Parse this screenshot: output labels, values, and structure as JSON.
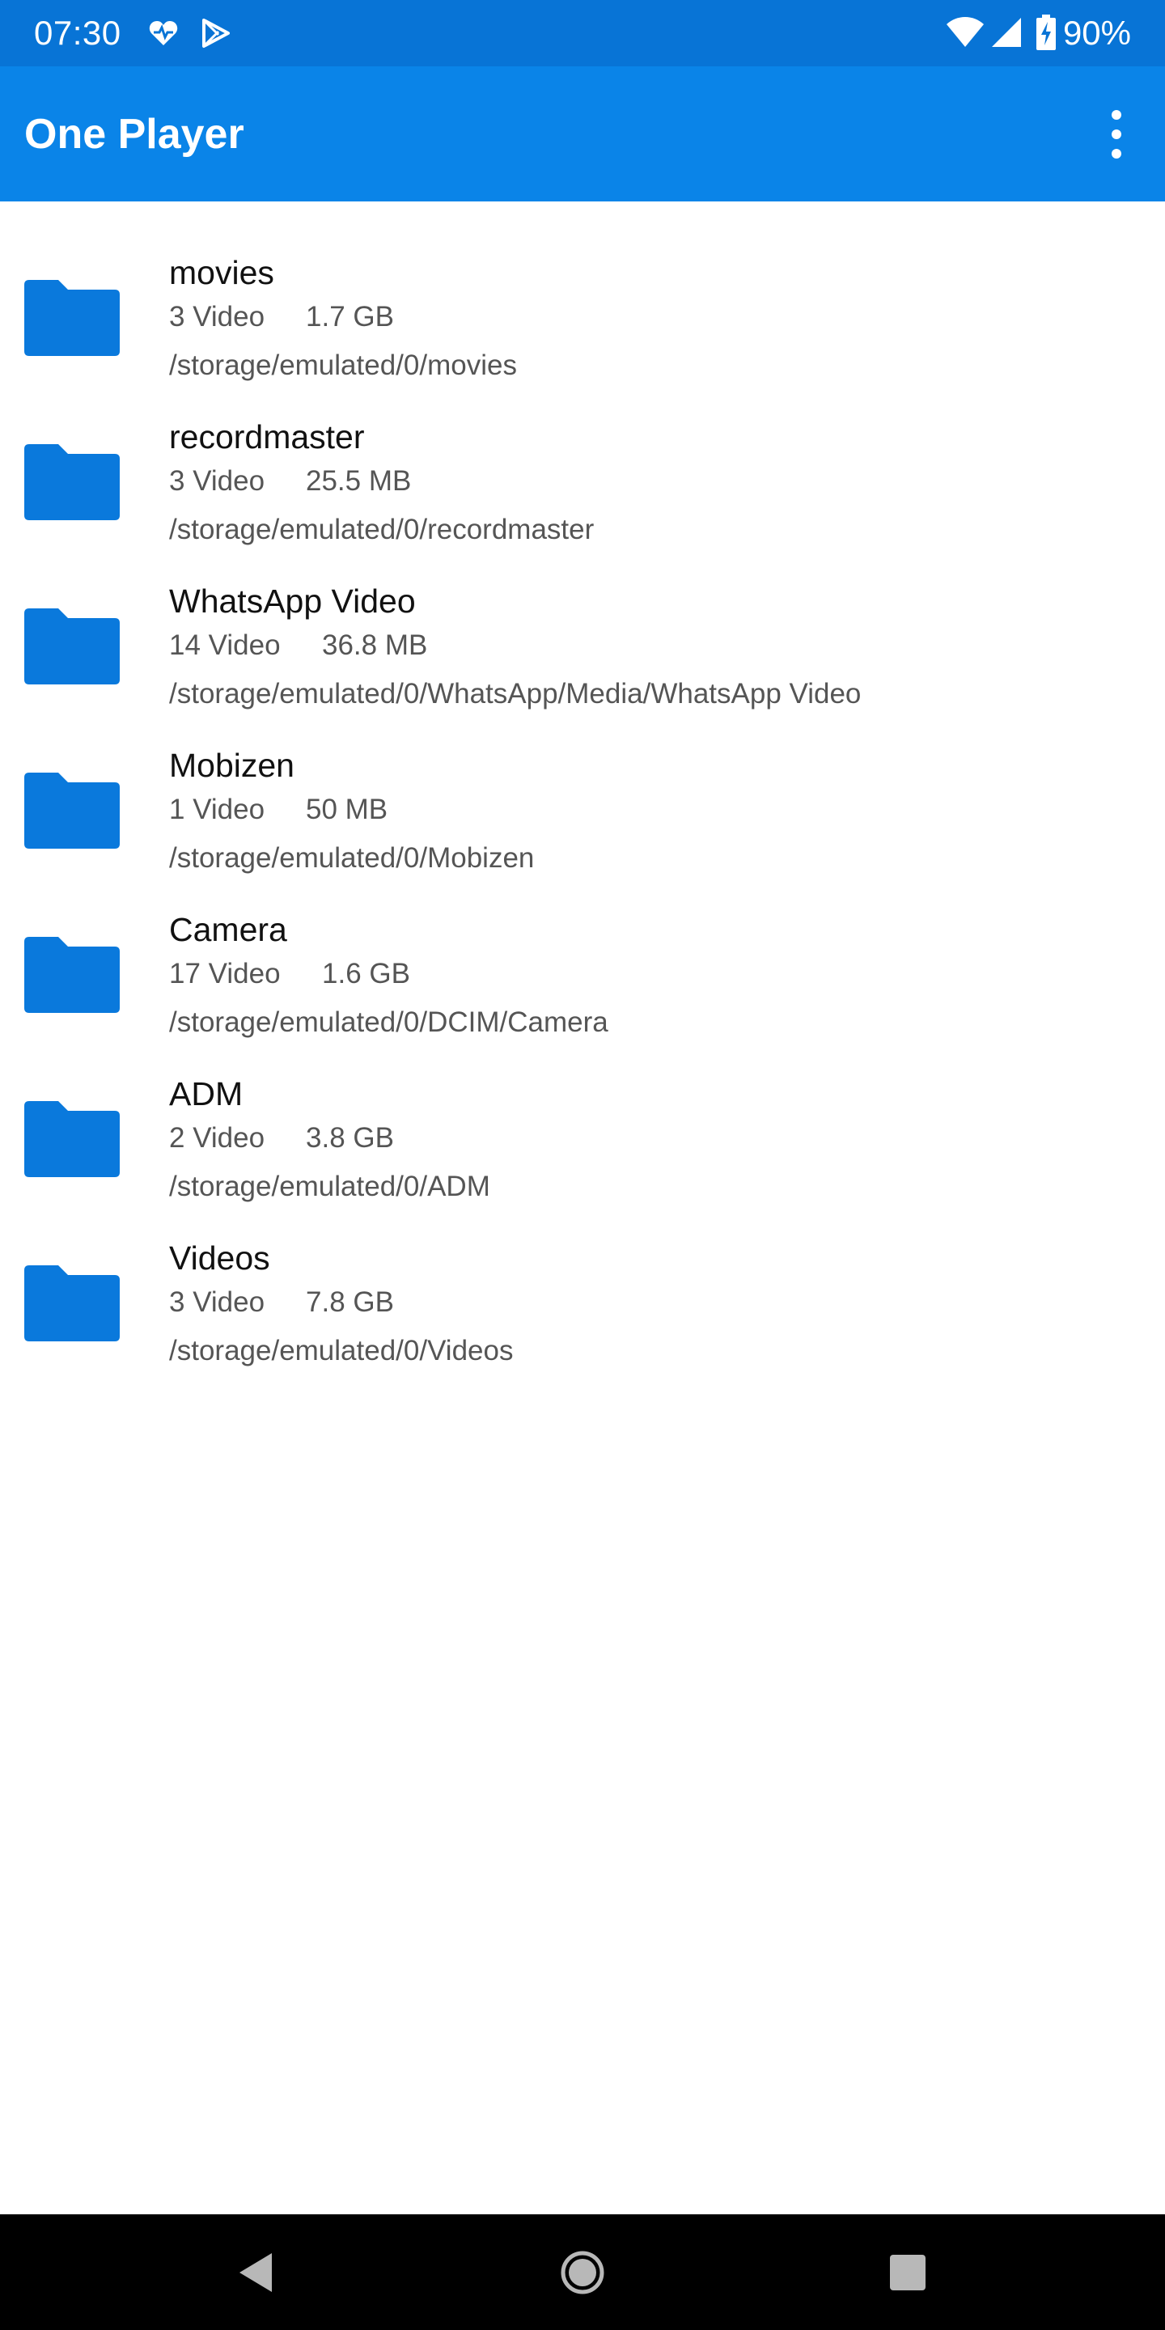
{
  "status_bar": {
    "time": "07:30",
    "battery": "90%",
    "icons": [
      "health-heart-icon",
      "play-store-icon",
      "wifi-icon",
      "signal-icon",
      "battery-charging-icon"
    ]
  },
  "app_bar": {
    "title": "One Player",
    "menu_icon": "more-vert-icon"
  },
  "folders": [
    {
      "name": "movies",
      "count": "3 Video",
      "size": "1.7 GB",
      "path": "/storage/emulated/0/movies"
    },
    {
      "name": "recordmaster",
      "count": "3 Video",
      "size": "25.5 MB",
      "path": "/storage/emulated/0/recordmaster"
    },
    {
      "name": "WhatsApp Video",
      "count": "14 Video",
      "size": "36.8 MB",
      "path": "/storage/emulated/0/WhatsApp/Media/WhatsApp Video"
    },
    {
      "name": "Mobizen",
      "count": "1 Video",
      "size": "50 MB",
      "path": "/storage/emulated/0/Mobizen"
    },
    {
      "name": "Camera",
      "count": "17 Video",
      "size": "1.6 GB",
      "path": "/storage/emulated/0/DCIM/Camera"
    },
    {
      "name": "ADM",
      "count": "2 Video",
      "size": "3.8 GB",
      "path": "/storage/emulated/0/ADM"
    },
    {
      "name": "Videos",
      "count": "3 Video",
      "size": "7.8 GB",
      "path": "/storage/emulated/0/Videos"
    }
  ],
  "colors": {
    "status_bar": "#0874d6",
    "app_bar": "#0a84e8",
    "folder_icon": "#0a79dc",
    "nav_bar": "#000000"
  },
  "nav_bar": {
    "buttons": [
      "back-icon",
      "home-icon",
      "recents-icon"
    ]
  }
}
